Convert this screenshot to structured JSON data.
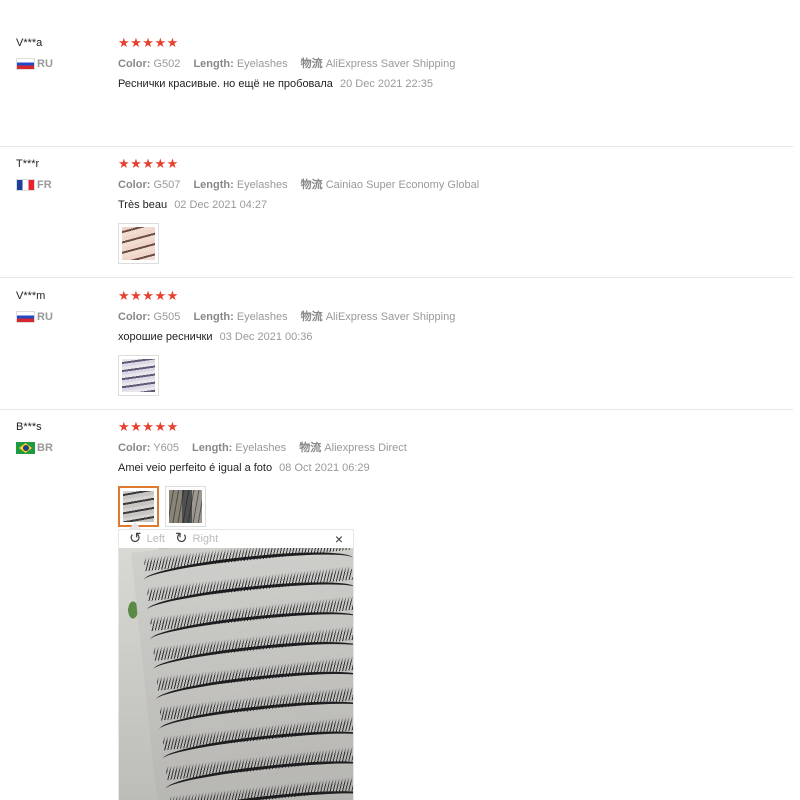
{
  "reviews": [
    {
      "user": "V***a",
      "country": "RU",
      "stars": "★★★★★",
      "color_label": "Color:",
      "color": "G502",
      "length_label": "Length:",
      "length": "Eyelashes",
      "logistics_label": "物流",
      "logistics": "AliExpress Saver Shipping",
      "text": "Реснички красивые. но ещё не пробовала",
      "date": "20 Dec 2021 22:35"
    },
    {
      "user": "T***r",
      "country": "FR",
      "stars": "★★★★★",
      "color_label": "Color:",
      "color": "G507",
      "length_label": "Length:",
      "length": "Eyelashes",
      "logistics_label": "物流",
      "logistics": "Cainiao Super Economy Global",
      "text": "Très beau",
      "date": "02 Dec 2021 04:27"
    },
    {
      "user": "V***m",
      "country": "RU",
      "stars": "★★★★★",
      "color_label": "Color:",
      "color": "G505",
      "length_label": "Length:",
      "length": "Eyelashes",
      "logistics_label": "物流",
      "logistics": "AliExpress Saver Shipping",
      "text": "хорошие реснички",
      "date": "03 Dec 2021 00:36"
    },
    {
      "user": "B***s",
      "country": "BR",
      "stars": "★★★★★",
      "color_label": "Color:",
      "color": "Y605",
      "length_label": "Length:",
      "length": "Eyelashes",
      "logistics_label": "物流",
      "logistics": "Aliexpress Direct",
      "text": "Amei veio perfeito é igual a foto",
      "date": "08 Oct 2021 06:29"
    }
  ],
  "viewer": {
    "left_label": "Left",
    "right_label": "Right",
    "rotate_left_icon": "↺",
    "rotate_right_icon": "↻",
    "close_icon": "×"
  },
  "colors": {
    "star": "#e6402e",
    "active_thumb_border": "#e07a31"
  }
}
